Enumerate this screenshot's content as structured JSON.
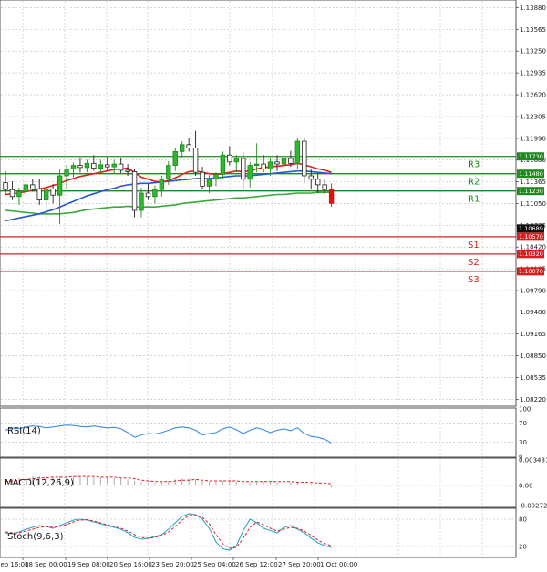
{
  "chart_data": [
    {
      "type": "candlestick",
      "panel": "price",
      "y_ticks": [
        "1.13880",
        "1.13565",
        "1.13250",
        "1.12935",
        "1.12620",
        "1.12305",
        "1.11990",
        "1.11680",
        "1.11365",
        "1.11050",
        "1.10735",
        "1.10420",
        "1.10105",
        "1.09790",
        "1.09480",
        "1.09165",
        "1.08850",
        "1.08535",
        "1.08220"
      ],
      "ylim": [
        1.0812,
        1.1399
      ],
      "x_ticks": [
        "18 Sep 00:00",
        "19 Sep 08:00",
        "20 Sep 16:00",
        "23 Sep 20:00",
        "25 Sep 04:00",
        "26 Sep 12:00",
        "27 Sep 20:00",
        "1 Oct 00:00"
      ],
      "x_tick_partial": "Sep 16:00",
      "current_price": "1.10689",
      "levels": [
        {
          "name": "R3",
          "value": 1.1173,
          "label": "1.11730",
          "color": "#1f8a1f"
        },
        {
          "name": "R2",
          "value": 1.1148,
          "label": "1.11480",
          "color": "#1f8a1f"
        },
        {
          "name": "R1",
          "value": 1.1123,
          "label": "1.11230",
          "color": "#1f8a1f"
        },
        {
          "name": "S1",
          "value": 1.1057,
          "label": "1.10570",
          "color": "#d42020"
        },
        {
          "name": "S2",
          "value": 1.1032,
          "label": "1.10320",
          "color": "#d42020"
        },
        {
          "name": "S3",
          "value": 1.1007,
          "label": "1.10070",
          "color": "#d42020"
        }
      ],
      "candles": [
        {
          "o": 1.1135,
          "h": 1.1152,
          "l": 1.1118,
          "c": 1.1125
        },
        {
          "o": 1.1125,
          "h": 1.1137,
          "l": 1.111,
          "c": 1.1115
        },
        {
          "o": 1.1115,
          "h": 1.1128,
          "l": 1.1103,
          "c": 1.1122
        },
        {
          "o": 1.1122,
          "h": 1.114,
          "l": 1.1116,
          "c": 1.1132
        },
        {
          "o": 1.1132,
          "h": 1.114,
          "l": 1.1122,
          "c": 1.1126
        },
        {
          "o": 1.1126,
          "h": 1.114,
          "l": 1.1103,
          "c": 1.111
        },
        {
          "o": 1.111,
          "h": 1.113,
          "l": 1.108,
          "c": 1.1126
        },
        {
          "o": 1.1126,
          "h": 1.1133,
          "l": 1.1105,
          "c": 1.1117
        },
        {
          "o": 1.1117,
          "h": 1.1155,
          "l": 1.1075,
          "c": 1.1145
        },
        {
          "o": 1.1145,
          "h": 1.1161,
          "l": 1.1125,
          "c": 1.1155
        },
        {
          "o": 1.1155,
          "h": 1.1164,
          "l": 1.1143,
          "c": 1.116
        },
        {
          "o": 1.116,
          "h": 1.1171,
          "l": 1.115,
          "c": 1.1157
        },
        {
          "o": 1.1157,
          "h": 1.1168,
          "l": 1.115,
          "c": 1.1163
        },
        {
          "o": 1.1163,
          "h": 1.1175,
          "l": 1.1152,
          "c": 1.1156
        },
        {
          "o": 1.1156,
          "h": 1.1168,
          "l": 1.1149,
          "c": 1.1161
        },
        {
          "o": 1.1161,
          "h": 1.1172,
          "l": 1.1153,
          "c": 1.1158
        },
        {
          "o": 1.1158,
          "h": 1.1168,
          "l": 1.1148,
          "c": 1.1162
        },
        {
          "o": 1.1162,
          "h": 1.117,
          "l": 1.1149,
          "c": 1.1153
        },
        {
          "o": 1.1153,
          "h": 1.1162,
          "l": 1.1145,
          "c": 1.1151
        },
        {
          "o": 1.1151,
          "h": 1.1155,
          "l": 1.1085,
          "c": 1.1095
        },
        {
          "o": 1.1095,
          "h": 1.1128,
          "l": 1.1085,
          "c": 1.112
        },
        {
          "o": 1.112,
          "h": 1.1133,
          "l": 1.111,
          "c": 1.1115
        },
        {
          "o": 1.1115,
          "h": 1.1131,
          "l": 1.1105,
          "c": 1.1125
        },
        {
          "o": 1.1125,
          "h": 1.1145,
          "l": 1.1115,
          "c": 1.114
        },
        {
          "o": 1.114,
          "h": 1.1166,
          "l": 1.1132,
          "c": 1.116
        },
        {
          "o": 1.116,
          "h": 1.1186,
          "l": 1.1152,
          "c": 1.118
        },
        {
          "o": 1.118,
          "h": 1.1195,
          "l": 1.117,
          "c": 1.119
        },
        {
          "o": 1.119,
          "h": 1.1199,
          "l": 1.118,
          "c": 1.1185
        },
        {
          "o": 1.1185,
          "h": 1.121,
          "l": 1.1145,
          "c": 1.115
        },
        {
          "o": 1.115,
          "h": 1.1158,
          "l": 1.1125,
          "c": 1.113
        },
        {
          "o": 1.113,
          "h": 1.1146,
          "l": 1.112,
          "c": 1.114
        },
        {
          "o": 1.114,
          "h": 1.115,
          "l": 1.113,
          "c": 1.1147
        },
        {
          "o": 1.1147,
          "h": 1.118,
          "l": 1.114,
          "c": 1.1175
        },
        {
          "o": 1.1175,
          "h": 1.1188,
          "l": 1.116,
          "c": 1.1165
        },
        {
          "o": 1.1165,
          "h": 1.1175,
          "l": 1.115,
          "c": 1.117
        },
        {
          "o": 1.117,
          "h": 1.118,
          "l": 1.1125,
          "c": 1.114
        },
        {
          "o": 1.114,
          "h": 1.1165,
          "l": 1.1128,
          "c": 1.116
        },
        {
          "o": 1.116,
          "h": 1.1192,
          "l": 1.115,
          "c": 1.1162
        },
        {
          "o": 1.1162,
          "h": 1.1175,
          "l": 1.115,
          "c": 1.1155
        },
        {
          "o": 1.1155,
          "h": 1.117,
          "l": 1.1145,
          "c": 1.1165
        },
        {
          "o": 1.1165,
          "h": 1.1175,
          "l": 1.1152,
          "c": 1.1162
        },
        {
          "o": 1.1162,
          "h": 1.1176,
          "l": 1.115,
          "c": 1.117
        },
        {
          "o": 1.117,
          "h": 1.1181,
          "l": 1.1158,
          "c": 1.1163
        },
        {
          "o": 1.1163,
          "h": 1.12,
          "l": 1.1155,
          "c": 1.1195
        },
        {
          "o": 1.1195,
          "h": 1.12,
          "l": 1.1135,
          "c": 1.1145
        },
        {
          "o": 1.1145,
          "h": 1.1155,
          "l": 1.1125,
          "c": 1.114
        },
        {
          "o": 1.114,
          "h": 1.1148,
          "l": 1.112,
          "c": 1.1132
        },
        {
          "o": 1.1132,
          "h": 1.1141,
          "l": 1.1118,
          "c": 1.1125
        },
        {
          "o": 1.1125,
          "h": 1.1134,
          "l": 1.11,
          "c": 1.1105
        }
      ],
      "ma_red": [
        1.1118,
        1.1119,
        1.112,
        1.1122,
        1.1124,
        1.1126,
        1.1128,
        1.1131,
        1.1134,
        1.1138,
        1.1141,
        1.1144,
        1.1146,
        1.1148,
        1.115,
        1.1152,
        1.1154,
        1.1155,
        1.1156,
        1.115,
        1.1143,
        1.114,
        1.1137,
        1.1136,
        1.1138,
        1.1142,
        1.1147,
        1.1151,
        1.1152,
        1.115,
        1.1148,
        1.1147,
        1.1148,
        1.115,
        1.1152,
        1.1151,
        1.1152,
        1.1155,
        1.1157,
        1.1158,
        1.1159,
        1.116,
        1.1161,
        1.1163,
        1.1161,
        1.1158,
        1.1155,
        1.1153,
        1.115
      ],
      "ma_blue": [
        1.108,
        1.1082,
        1.1084,
        1.1086,
        1.1088,
        1.109,
        1.1093,
        1.1096,
        1.11,
        1.1104,
        1.1108,
        1.1112,
        1.1116,
        1.1119,
        1.1122,
        1.1125,
        1.1127,
        1.113,
        1.1132,
        1.1133,
        1.1134,
        1.1134,
        1.1135,
        1.1136,
        1.1137,
        1.1138,
        1.1139,
        1.114,
        1.1141,
        1.1141,
        1.1141,
        1.1142,
        1.1143,
        1.1144,
        1.1145,
        1.1145,
        1.1145,
        1.1146,
        1.1147,
        1.1148,
        1.1149,
        1.115,
        1.1151,
        1.1152,
        1.1152,
        1.1151,
        1.115,
        1.1149,
        1.1148
      ],
      "ma_green": [
        1.1095,
        1.1094,
        1.1093,
        1.1092,
        1.1091,
        1.109,
        1.109,
        1.109,
        1.109,
        1.1091,
        1.1092,
        1.1094,
        1.1096,
        1.1097,
        1.1098,
        1.1099,
        1.11,
        1.11,
        1.1101,
        1.11,
        1.11,
        1.11,
        1.11,
        1.1101,
        1.1102,
        1.1103,
        1.1105,
        1.1106,
        1.1107,
        1.1108,
        1.1109,
        1.111,
        1.1111,
        1.1112,
        1.1113,
        1.1113,
        1.1114,
        1.1115,
        1.1116,
        1.1117,
        1.1118,
        1.1118,
        1.1119,
        1.112,
        1.112,
        1.112,
        1.1121,
        1.1121,
        1.1121
      ]
    },
    {
      "type": "line",
      "panel": "rsi",
      "label": "RSI(14)",
      "y_ticks": [
        "100",
        "70",
        "30",
        "0"
      ],
      "ylim": [
        0,
        100
      ],
      "series": [
        {
          "values": [
            55,
            60,
            58,
            62,
            64,
            63,
            60,
            62,
            64,
            66,
            65,
            63,
            62,
            64,
            62,
            60,
            61,
            58,
            50,
            40,
            45,
            48,
            47,
            50,
            55,
            60,
            62,
            60,
            55,
            45,
            48,
            50,
            58,
            62,
            56,
            48,
            55,
            60,
            56,
            50,
            55,
            58,
            54,
            60,
            48,
            42,
            40,
            36,
            28
          ]
        }
      ]
    },
    {
      "type": "bar",
      "panel": "macd",
      "label": "MACD(12,26,9)",
      "y_ticks": [
        "0.003431",
        "0.00",
        "-0.002726"
      ],
      "ylim": [
        -0.002726,
        0.003431
      ],
      "histogram": [
        0.0006,
        0.0008,
        0.001,
        0.0011,
        0.0012,
        0.0012,
        0.0012,
        0.0011,
        0.0012,
        0.0012,
        0.0012,
        0.0012,
        0.0012,
        0.0011,
        0.0011,
        0.0011,
        0.001,
        0.001,
        0.0008,
        0.0006,
        0.0004,
        0.0003,
        0.0003,
        0.0004,
        0.0006,
        0.0008,
        0.0009,
        0.0009,
        0.0008,
        0.0006,
        0.0005,
        0.0005,
        0.0006,
        0.0006,
        0.0005,
        0.0004,
        0.0004,
        0.0004,
        0.0004,
        0.0004,
        0.0004,
        0.0004,
        0.0004,
        0.0004,
        0.0003,
        0.0002,
        0.0001,
        0.0,
        -0.0003
      ],
      "signal": [
        0.0005,
        0.0006,
        0.0007,
        0.0008,
        0.0009,
        0.001,
        0.001,
        0.0011,
        0.0011,
        0.0011,
        0.0012,
        0.0012,
        0.0012,
        0.0012,
        0.0011,
        0.0011,
        0.0011,
        0.001,
        0.001,
        0.0009,
        0.0007,
        0.0006,
        0.0005,
        0.0005,
        0.0005,
        0.0006,
        0.0007,
        0.0007,
        0.0008,
        0.0007,
        0.0006,
        0.0006,
        0.0006,
        0.0006,
        0.0006,
        0.0005,
        0.0005,
        0.0005,
        0.0005,
        0.0005,
        0.0005,
        0.0005,
        0.0005,
        0.0004,
        0.0004,
        0.0004,
        0.0003,
        0.0003,
        0.0002
      ]
    },
    {
      "type": "line",
      "panel": "stoch",
      "label": "Stoch(9,6,3)",
      "y_ticks": [
        "80",
        "20"
      ],
      "ylim": [
        0,
        100
      ],
      "series": [
        {
          "values": [
            50,
            48,
            52,
            58,
            62,
            66,
            64,
            60,
            66,
            72,
            78,
            80,
            78,
            74,
            70,
            66,
            62,
            58,
            50,
            40,
            36,
            38,
            42,
            46,
            58,
            72,
            86,
            92,
            90,
            80,
            60,
            30,
            15,
            12,
            22,
            55,
            80,
            72,
            60,
            55,
            50,
            62,
            66,
            58,
            50,
            38,
            28,
            22,
            18
          ]
        },
        {
          "values": [
            52,
            50,
            50,
            54,
            58,
            62,
            64,
            62,
            64,
            68,
            74,
            78,
            79,
            76,
            72,
            68,
            64,
            60,
            54,
            46,
            40,
            38,
            40,
            44,
            52,
            64,
            78,
            88,
            90,
            84,
            70,
            46,
            26,
            16,
            18,
            38,
            62,
            74,
            68,
            60,
            54,
            58,
            62,
            60,
            54,
            44,
            34,
            26,
            22
          ]
        }
      ]
    }
  ]
}
